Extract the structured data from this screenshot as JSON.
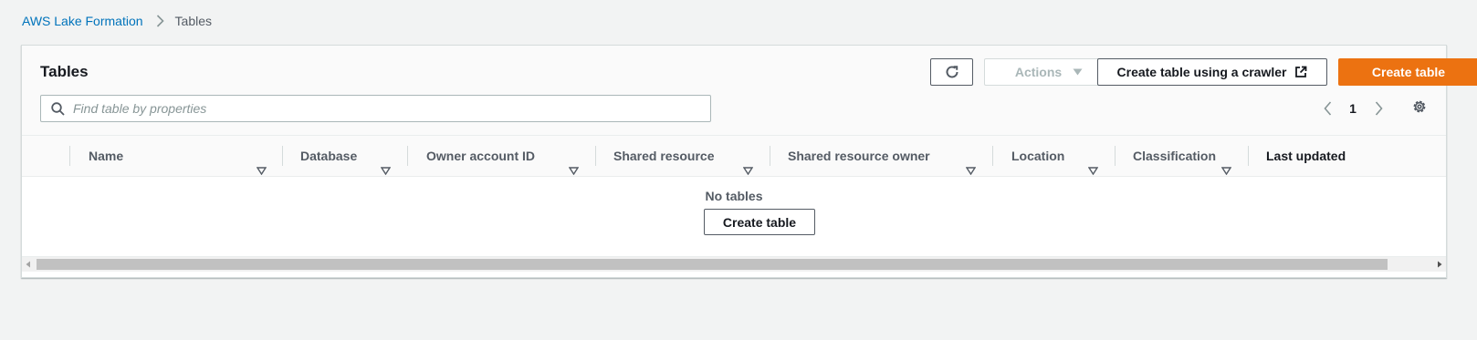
{
  "breadcrumb": {
    "items": [
      "AWS Lake Formation",
      "Tables"
    ]
  },
  "panel": {
    "title": "Tables"
  },
  "toolbar": {
    "refresh_icon": "refresh-icon",
    "actions_label": "Actions",
    "crawler_label": "Create table using a crawler",
    "create_label": "Create table"
  },
  "search": {
    "placeholder": "Find table by properties",
    "value": ""
  },
  "pagination": {
    "current_page": "1"
  },
  "table": {
    "columns": [
      "Name",
      "Database",
      "Owner account ID",
      "Shared resource",
      "Shared resource owner",
      "Location",
      "Classification",
      "Last updated"
    ],
    "rows": [],
    "empty_text": "No tables",
    "empty_button_label": "Create table"
  },
  "colors": {
    "link": "#0073bb",
    "primary": "#ec7211",
    "text": "#16191f",
    "muted": "#545b64"
  }
}
